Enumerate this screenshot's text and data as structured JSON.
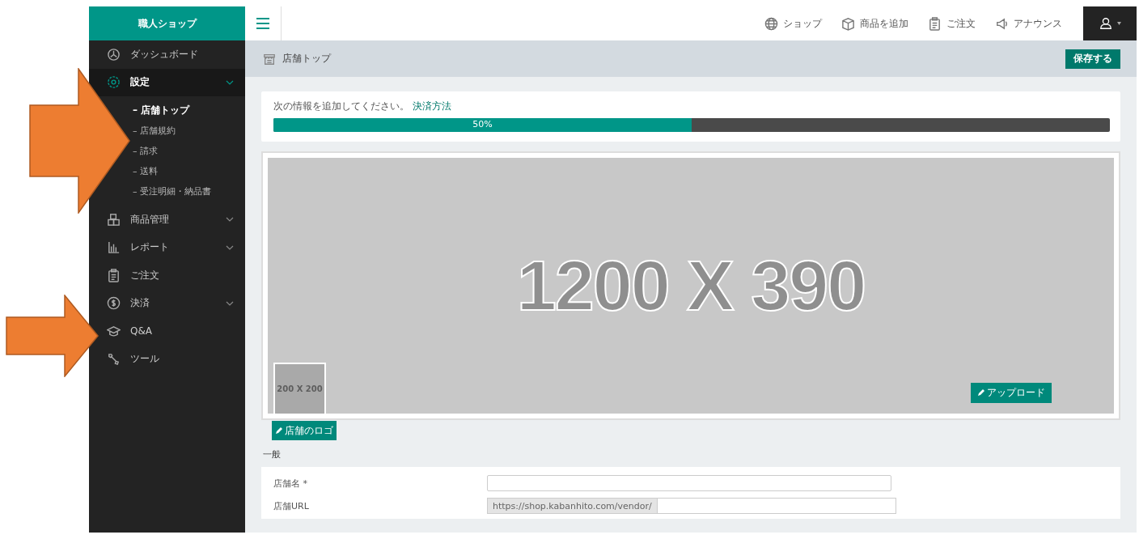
{
  "shop_name": "職人ショップ",
  "sidebar": {
    "items": [
      {
        "label": "ダッシュボード",
        "selected": false
      },
      {
        "label": "設定",
        "selected": true,
        "expanded": true,
        "children": [
          {
            "label": "– 店舗トップ",
            "selected": true
          },
          {
            "label": "– 店舗規約",
            "selected": false
          },
          {
            "label": "– 請求",
            "selected": false
          },
          {
            "label": "– 送料",
            "selected": false
          },
          {
            "label": "– 受注明細・納品書",
            "selected": false
          }
        ]
      },
      {
        "label": "商品管理",
        "selected": false,
        "expanded": false
      },
      {
        "label": "レポート",
        "selected": false,
        "expanded": false
      },
      {
        "label": "ご注文",
        "selected": false
      },
      {
        "label": "決済",
        "selected": false,
        "expanded": false
      },
      {
        "label": "Q&A",
        "selected": false
      },
      {
        "label": "ツール",
        "selected": false
      }
    ]
  },
  "topbar": {
    "links": [
      {
        "label": "ショップ"
      },
      {
        "label": "商品を追加"
      },
      {
        "label": "ご注文"
      },
      {
        "label": "アナウンス"
      }
    ]
  },
  "page_header": {
    "title": "店舗トップ",
    "save_button": "保存する"
  },
  "progress": {
    "message": "次の情報を追加してください。",
    "link": "決済方法",
    "level": 0.5,
    "reading": "50%"
  },
  "banner": {
    "placeholder": "1200 X 390",
    "logo_placeholder": "200 X 200",
    "upload_button": "アップロード",
    "logo_button": "店舗のロゴ"
  },
  "general": {
    "heading": "一般",
    "fields": [
      {
        "kind": "text",
        "label": "店舗名 *"
      },
      {
        "kind": "url",
        "label": "店舗URL",
        "prefix": "https://shop.kabanhito.com/vendor/"
      }
    ]
  },
  "annotation_arrows": [
    {
      "kind": "large"
    },
    {
      "kind": "small"
    }
  ]
}
